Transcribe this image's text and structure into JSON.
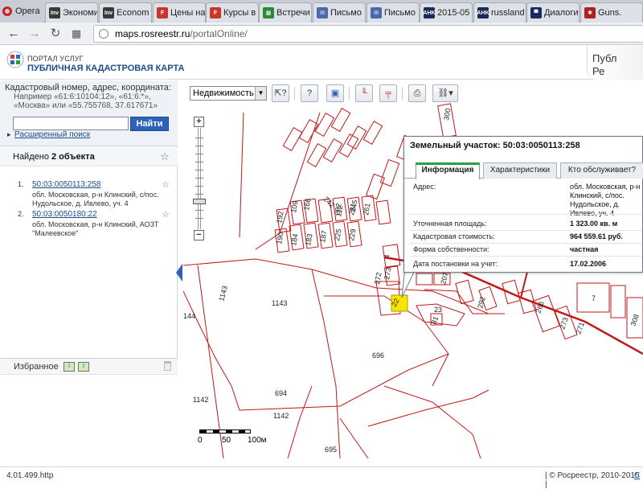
{
  "browser": {
    "menu_label": "Opera",
    "tabs": [
      {
        "title": "Экономи",
        "icon": "inv-favicon",
        "color": "#3a3a3a",
        "glyph": "Inv"
      },
      {
        "title": "Econom",
        "icon": "inv-favicon",
        "color": "#3a3a3a",
        "glyph": "Inv"
      },
      {
        "title": "Цены на",
        "icon": "n-favicon",
        "color": "#c8372c",
        "glyph": "F"
      },
      {
        "title": "Курсы в",
        "icon": "n-favicon",
        "color": "#c8372c",
        "glyph": "F"
      },
      {
        "title": "Встречи",
        "icon": "sheet-favicon",
        "color": "#2a8a3a",
        "glyph": "▦"
      },
      {
        "title": "Письмо",
        "icon": "mail-favicon",
        "color": "#4a6ab0",
        "glyph": "✉"
      },
      {
        "title": "Письмо",
        "icon": "mail-favicon",
        "color": "#4a6ab0",
        "glyph": "✉"
      },
      {
        "title": "2015-05",
        "icon": "ahk-favicon",
        "color": "#1a2a5a",
        "glyph": "AHK"
      },
      {
        "title": "russland",
        "icon": "ahk-favicon",
        "color": "#1a2a5a",
        "glyph": "AHK"
      },
      {
        "title": "Диалоги",
        "icon": "dialogs-favicon",
        "color": "#1a2a5a",
        "glyph": "▀"
      },
      {
        "title": "Guns.",
        "icon": "guns-favicon",
        "color": "#b02020",
        "glyph": "✱"
      }
    ],
    "url_domain": "maps.rosreestr.ru",
    "url_path": "/portalOnline/"
  },
  "header": {
    "logo_top": "ПОРТАЛ УСЛУГ",
    "logo_main": "ПУБЛИЧНАЯ КАДАСТРОВАЯ КАРТА",
    "right_label": "Публ",
    "right_label_2": "Ре"
  },
  "search": {
    "title": "Кадастровый номер, адрес, координата:",
    "hint": "Например «61:6:10104:12», «61:6:*», «Москва» или «55.755768, 37.617671»",
    "value": "",
    "button": "Найти",
    "advanced": "Расширенный поиск"
  },
  "found": {
    "title_prefix": "Найдено ",
    "title_count": "2 объекта",
    "results": [
      {
        "num": "1.",
        "cadastral": "50:03:0050113:258",
        "address": "обл. Московская, р-н Клинский, с/пос. Нудольское, д. Ивлево, уч. 4"
      },
      {
        "num": "2.",
        "cadastral": "50:03:0050180:22",
        "address": "обл. Московская, р-н Клинский, АОЗТ \"Малеевское\""
      }
    ]
  },
  "favorites": {
    "title": "Избранное"
  },
  "toolbar": {
    "layer": "Недвижимость"
  },
  "popup": {
    "title": "Земельный участок: 50:03:0050113:258",
    "tabs": [
      "Информация",
      "Характеристики",
      "Кто обслуживает?"
    ],
    "rows": [
      {
        "label": "Адрес:",
        "value": "обл. Московская, р-н Клинский, с/пос. Нудольское, д. Ивлево, уч. 4"
      },
      {
        "label": "Уточненная площадь:",
        "value": "1 323.00 кв. м"
      },
      {
        "label": "Кадастровая стоимость:",
        "value": "964 559.61 руб."
      },
      {
        "label": "Форма собственности:",
        "value": "частная"
      },
      {
        "label": "Дата постановки на учет:",
        "value": "17.02.2006"
      }
    ]
  },
  "map": {
    "scale_labels": [
      "0",
      "50",
      "100м"
    ],
    "parcel_labels": [
      "1143",
      "1143",
      "144",
      "696",
      "694",
      "1142",
      "1142",
      "695",
      "22",
      "23",
      "81",
      "192",
      "190",
      "184",
      "183",
      "109",
      "166",
      "187",
      "225",
      "229",
      "282",
      "281",
      "261",
      "272",
      "242",
      "112",
      "245",
      "4",
      "273",
      "207",
      "292",
      "266",
      "7",
      "273",
      "271",
      "308",
      "300",
      "2"
    ]
  },
  "status": {
    "version": "4.01.499.http",
    "copyright": "| © Росреестр, 2010-2015 |",
    "link": "С"
  }
}
